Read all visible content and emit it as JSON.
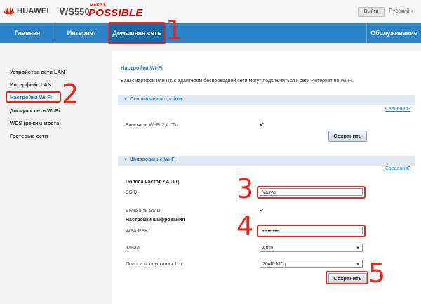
{
  "header": {
    "brand": "HUAWEI",
    "model": "WS550",
    "slogan_small": "MAKE it",
    "slogan_big": "POSSIBLE",
    "exit_button": "Выйти",
    "language": "Русский"
  },
  "nav": {
    "items": [
      {
        "label": "Главная"
      },
      {
        "label": "Интернет"
      },
      {
        "label": "Домашняя сеть"
      },
      {
        "label": "Обслуживание"
      }
    ],
    "active_index": 2
  },
  "sidebar": {
    "items": [
      {
        "label": "Устройства сети LAN"
      },
      {
        "label": "Интерфейс LAN"
      },
      {
        "label": "Настройки Wi-Fi"
      },
      {
        "label": "Доступ к сети Wi-Fi"
      },
      {
        "label": "WDS (режим моста)"
      },
      {
        "label": "Гостевые сети"
      }
    ],
    "active_index": 2
  },
  "page": {
    "title": "Настройки Wi-Fi",
    "description": "Ваш смартфон или ПК с адаптером беспроводной сети могут подключиться к сети Интернет по Wi-Fi."
  },
  "basic_section": {
    "title": "Основные настройки",
    "details_link": "Сведения?",
    "enable_wifi_label": "Включить Wi-Fi 2,4 ГГц:",
    "enable_wifi_checked": true,
    "save_label": "Сохранить"
  },
  "encryption_section": {
    "title": "Шифрование Wi-Fi",
    "details_link": "Сведения?",
    "band_title": "Полоса частот 2,4 ГГц",
    "ssid_label": "SSID:",
    "ssid_value": "Vasya",
    "enable_ssid_label": "Включить SSID:",
    "enable_ssid_checked": true,
    "encryption_title": "Настройки шифрования",
    "wpa_label": "WPA-PSK:",
    "wpa_value": "••••••••••",
    "channel_label": "Канал:",
    "channel_value": "Авто",
    "bandwidth_label": "Полоса пропускания 11n:",
    "bandwidth_value": "20/40 МГц",
    "save_label": "Сохранить"
  },
  "annotations": [
    "1",
    "2",
    "3",
    "4",
    "5"
  ],
  "colors": {
    "nav_blue": "#2c84c8",
    "nav_active": "#1668a9",
    "annotation_red": "#e8281e",
    "link_blue": "#2a7bc0"
  }
}
